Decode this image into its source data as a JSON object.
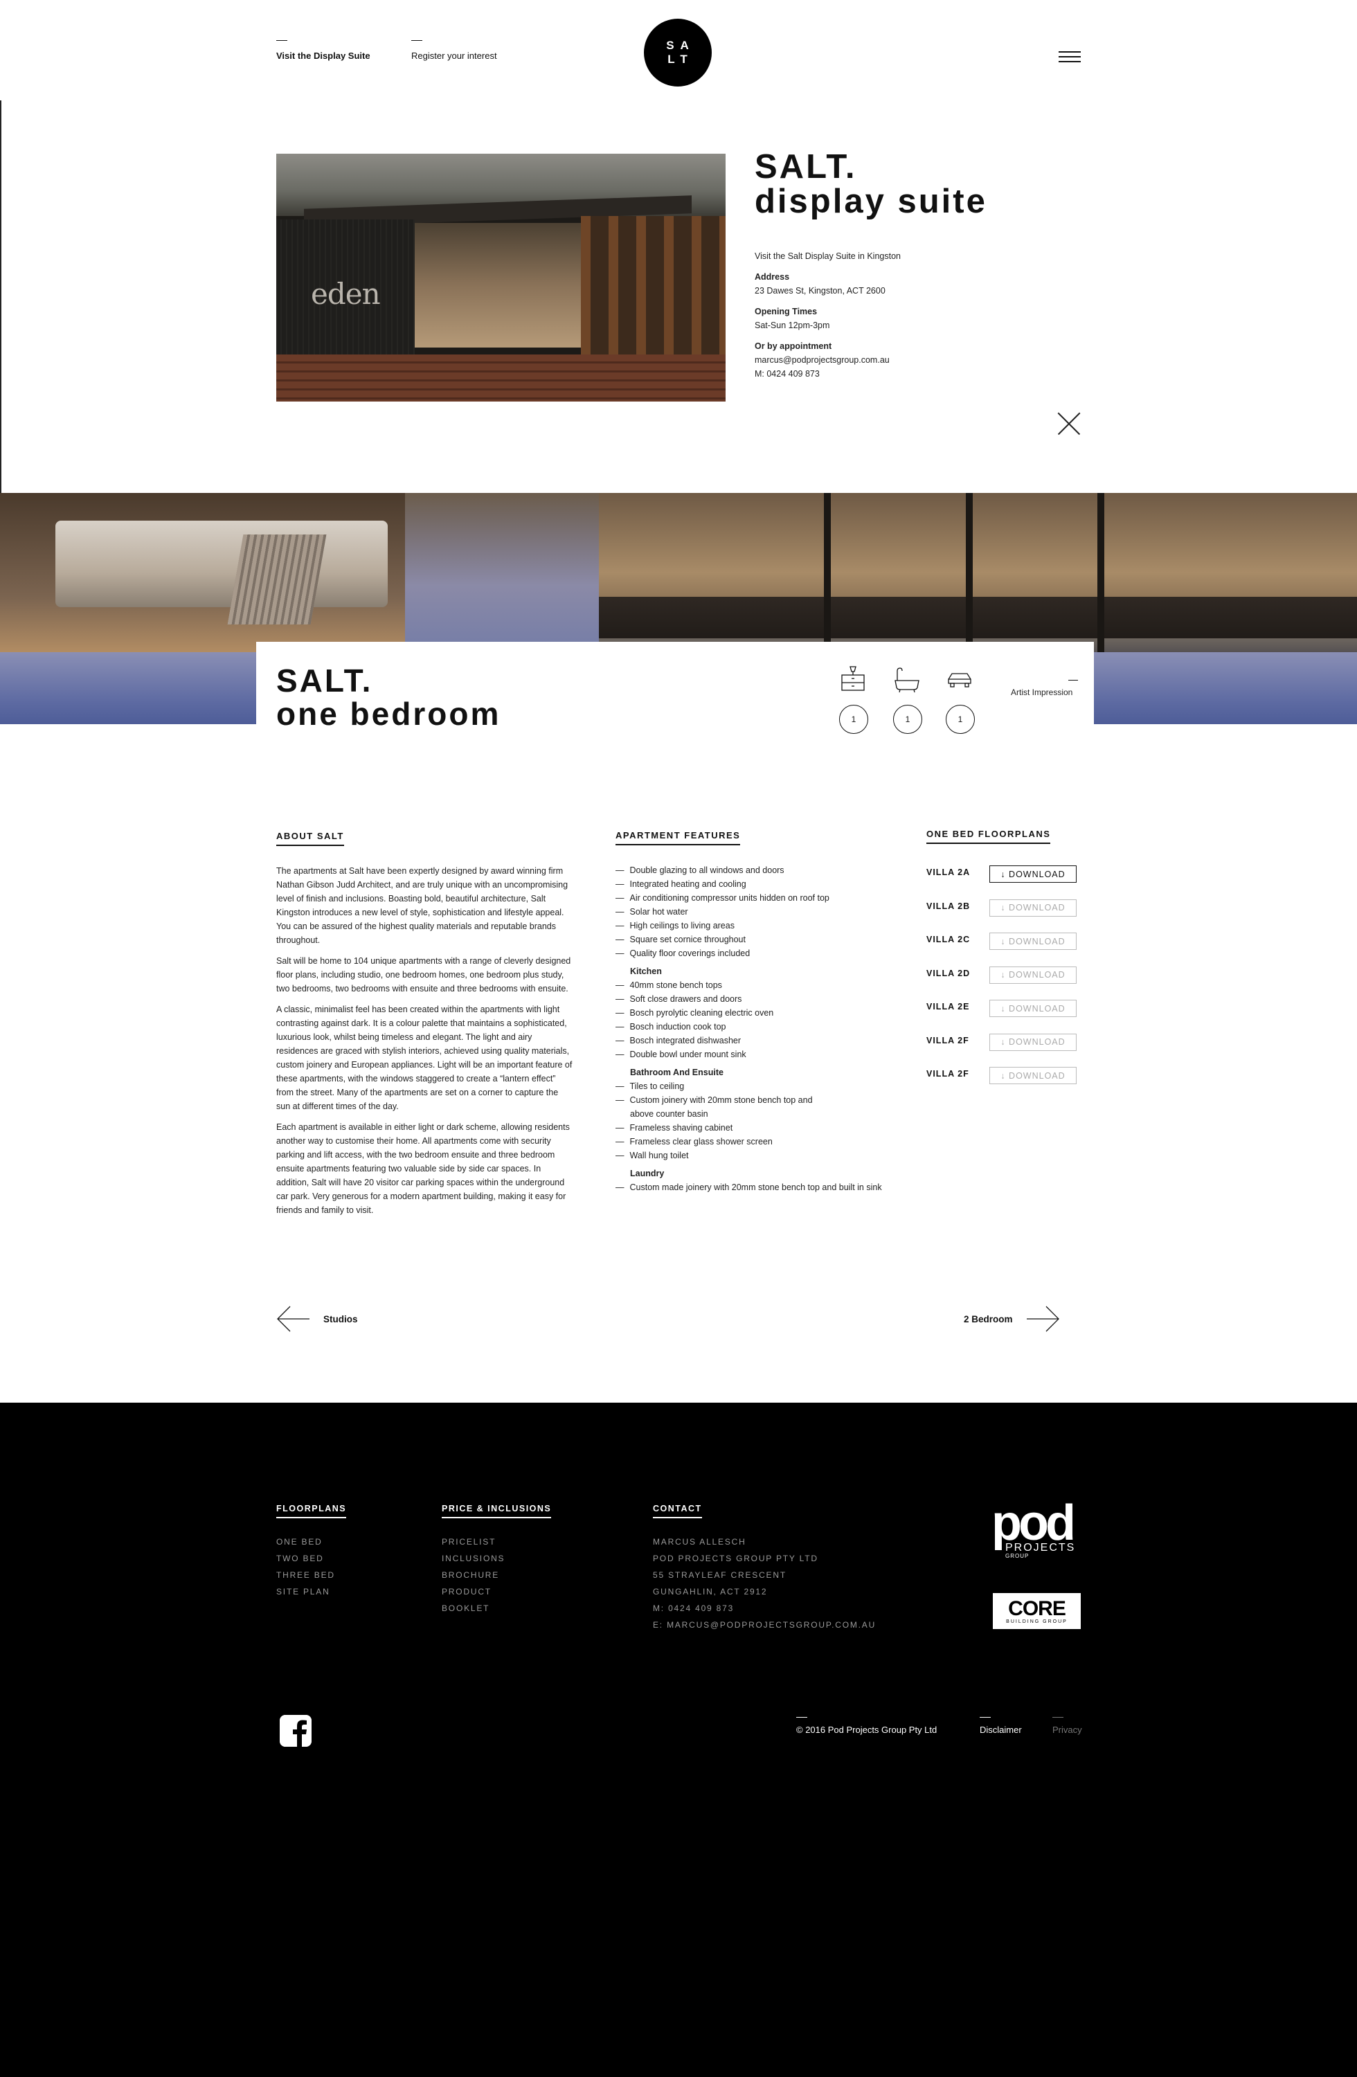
{
  "header": {
    "nav_visit": "Visit the Display Suite",
    "nav_register": "Register your  interest",
    "logo_line1": "SA",
    "logo_line2": "LT"
  },
  "display_suite": {
    "title_line1": "SALT.",
    "title_line2": "display suite",
    "photo_sign": "eden",
    "intro": "Visit the Salt Display Suite in Kingston",
    "address_label": "Address",
    "address": "23 Dawes St, Kingston, ACT 2600",
    "hours_label": "Opening Times",
    "hours": "Sat-Sun 12pm-3pm",
    "appointment_label": "Or by appointment",
    "email": "marcus@podprojectsgroup.com.au",
    "phone": "M: 0424 409 873"
  },
  "unit": {
    "title_line1": "SALT.",
    "title_line2": "one bedroom",
    "bedrooms": "1",
    "bathrooms": "1",
    "car_spaces": "1",
    "artist_impression": "Artist Impression"
  },
  "about": {
    "heading": "ABOUT SALT",
    "paragraphs": [
      "The apartments at Salt have been expertly designed by award winning firm Nathan Gibson Judd Architect, and are truly unique with an uncompromising level of finish and inclusions. Boasting bold, beautiful architecture, Salt Kingston introduces a new level of style, sophistication and lifestyle appeal. You can be assured of the highest quality materials and reputable brands throughout.",
      "Salt will be home to 104 unique apartments with a range of cleverly designed floor plans, including studio, one bedroom homes, one bedroom plus study, two bedrooms, two bedrooms with ensuite and three bedrooms with ensuite.",
      "A classic, minimalist feel has been created within the apartments with light contrasting against dark. It is a colour palette that maintains a sophisticated, luxurious look, whilst being timeless and elegant.  The light and airy residences are graced with stylish interiors, achieved using quality materials, custom joinery and European appliances. Light will be an important feature of these apartments, with the windows staggered to create a “lantern effect” from the street. Many of the apartments are set on a corner to capture the sun at different times of the day.",
      "Each apartment is available in either light or dark scheme, allowing residents another way to customise their home. All apartments come with security parking and lift access, with the two bedroom ensuite and three bedroom ensuite apartments featuring two valuable side by side car spaces. In addition, Salt will have 20 visitor car parking spaces within the underground car park. Very generous for a modern apartment building, making it easy for friends and family to visit."
    ]
  },
  "features": {
    "heading": "APARTMENT FEATURES",
    "general": [
      "Double glazing to all windows and doors",
      "Integrated heating and cooling",
      "Air conditioning compressor units hidden on roof top",
      "Solar hot water",
      "High ceilings to living areas",
      "Square set cornice throughout",
      "Quality floor coverings included"
    ],
    "kitchen_label": "Kitchen",
    "kitchen": [
      "40mm stone bench tops",
      "Soft close drawers and doors",
      "Bosch pyrolytic cleaning electric oven",
      "Bosch induction cook top",
      "Bosch integrated dishwasher",
      "Double bowl under mount sink"
    ],
    "bathroom_label": "Bathroom And Ensuite",
    "bathroom_1": "Tiles to ceiling",
    "bathroom_2a": "Custom joinery with 20mm stone bench top and",
    "bathroom_2b": "above counter basin",
    "bathroom_3": "Frameless shaving cabinet",
    "bathroom_4": "Frameless clear glass shower screen",
    "bathroom_5": "Wall hung toilet",
    "laundry_label": "Laundry",
    "laundry_1": "Custom made joinery with 20mm stone bench top and built in sink"
  },
  "floorplans": {
    "heading": "ONE BED FLOORPLANS",
    "download_label": "↓ DOWNLOAD",
    "items": [
      {
        "name": "VILLA 2A"
      },
      {
        "name": "VILLA 2B"
      },
      {
        "name": "VILLA 2C"
      },
      {
        "name": "VILLA 2D"
      },
      {
        "name": "VILLA 2E"
      },
      {
        "name": "VILLA 2F"
      },
      {
        "name": "VILLA 2F"
      }
    ]
  },
  "pager": {
    "prev": "Studios",
    "next": "2 Bedroom"
  },
  "footer": {
    "floorplans_heading": "FLOORPLANS",
    "floorplans": [
      "ONE BED",
      "TWO BED",
      "THREE BED",
      "SITE PLAN"
    ],
    "price_heading": "PRICE & INCLUSIONS",
    "price": [
      "PRICELIST",
      "INCLUSIONS",
      "BROCHURE",
      "PRODUCT",
      "BOOKLET"
    ],
    "contact_heading": "CONTACT",
    "contact": [
      "MARCUS ALLESCH",
      "POD PROJECTS GROUP PTY LTD",
      "55 STRAYLEAF CRESCENT",
      "GUNGAHLIN, ACT 2912",
      "M: 0424 409 873",
      "E: MARCUS@PODPROJECTSGROUP.COM.AU"
    ],
    "pod_logo_top": "pod",
    "pod_logo_mid": "PROJECTS",
    "pod_logo_bottom": "GROUP",
    "core_logo_big": "CORE",
    "core_logo_small": "BUILDING GROUP",
    "copyright": "© 2016 Pod Projects Group Pty Ltd",
    "disclaimer": "Disclaimer",
    "privacy": "Privacy"
  }
}
